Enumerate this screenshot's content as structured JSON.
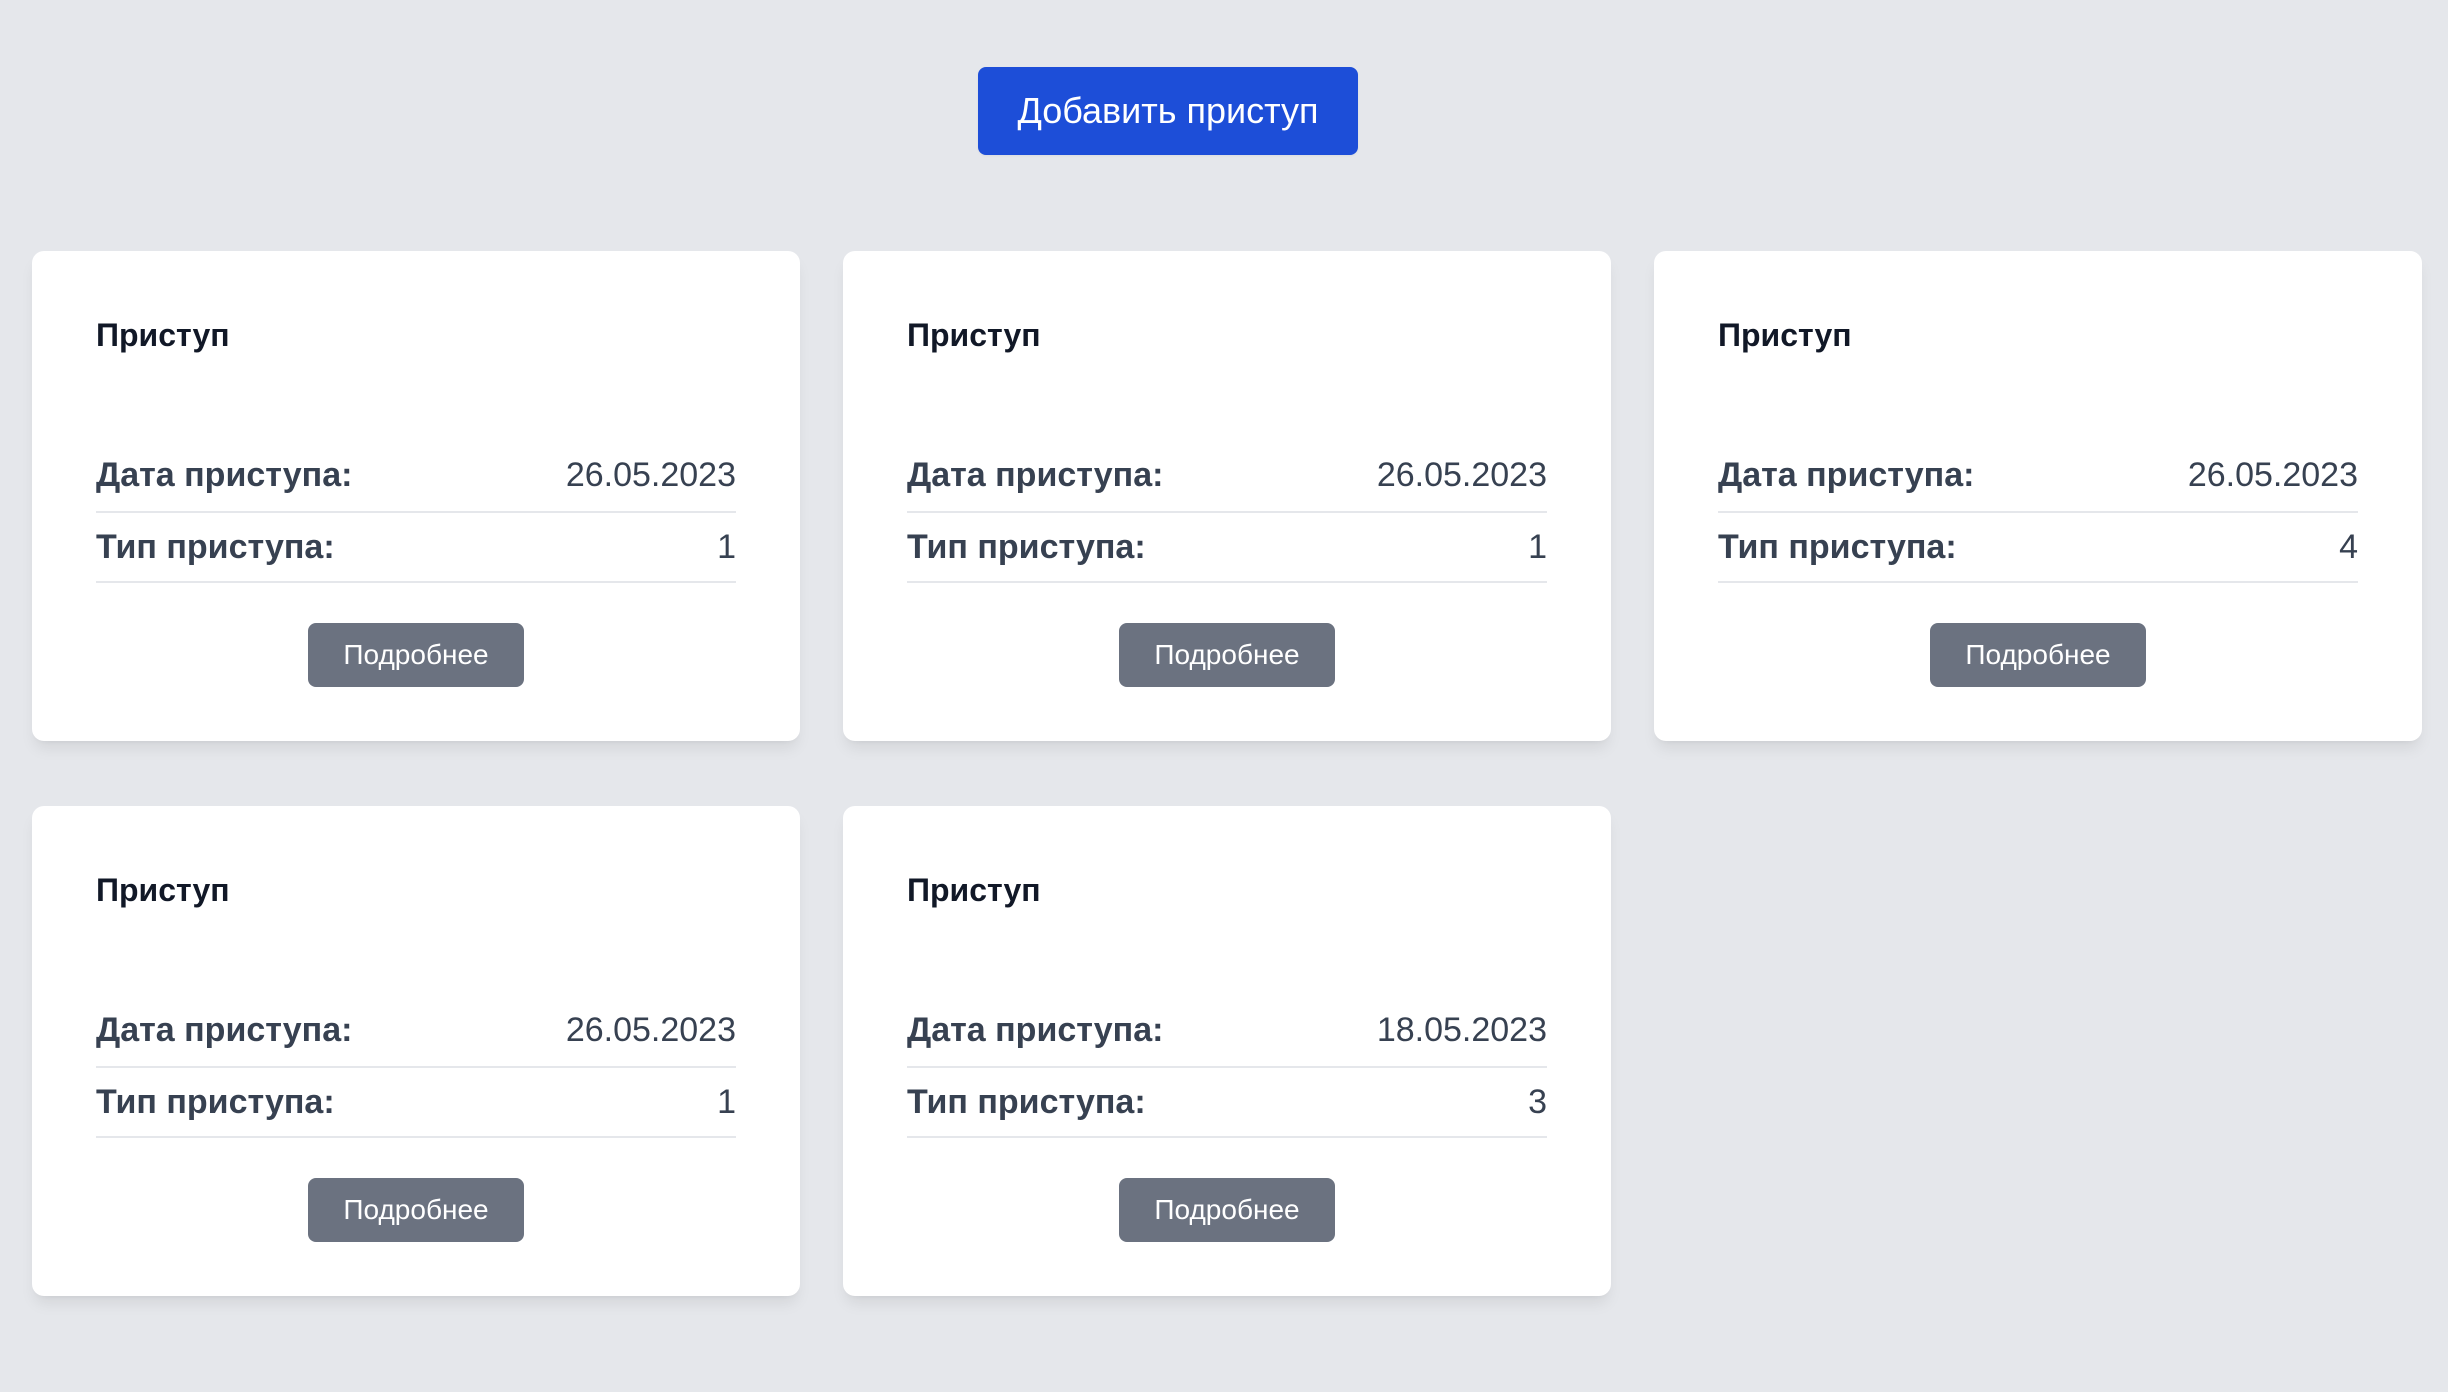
{
  "add_button_label": "Добавить приступ",
  "colors": {
    "background": "#e5e7eb",
    "primary_button": "#1d4ed8",
    "secondary_button": "#6b7280",
    "card": "#ffffff"
  },
  "cards": [
    {
      "title": "Приступ",
      "date_label": "Дата приступа:",
      "date_value": "26.05.2023",
      "type_label": "Тип приступа:",
      "type_value": "1",
      "details_label": "Подробнее"
    },
    {
      "title": "Приступ",
      "date_label": "Дата приступа:",
      "date_value": "26.05.2023",
      "type_label": "Тип приступа:",
      "type_value": "1",
      "details_label": "Подробнее"
    },
    {
      "title": "Приступ",
      "date_label": "Дата приступа:",
      "date_value": "26.05.2023",
      "type_label": "Тип приступа:",
      "type_value": "4",
      "details_label": "Подробнее"
    },
    {
      "title": "Приступ",
      "date_label": "Дата приступа:",
      "date_value": "26.05.2023",
      "type_label": "Тип приступа:",
      "type_value": "1",
      "details_label": "Подробнее"
    },
    {
      "title": "Приступ",
      "date_label": "Дата приступа:",
      "date_value": "18.05.2023",
      "type_label": "Тип приступа:",
      "type_value": "3",
      "details_label": "Подробнее"
    }
  ]
}
